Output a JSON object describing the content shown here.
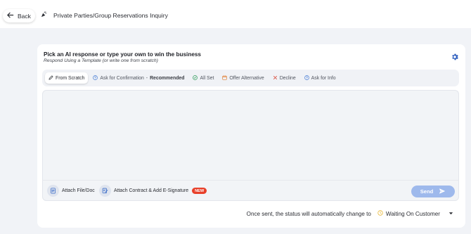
{
  "header": {
    "back_label": "Back",
    "page_title": "Private Parties/Group Reservations Inquiry"
  },
  "composer": {
    "heading": "Pick an AI response or type your own to win the business",
    "subheading": "Respond Using a Template (or write one from scratch)",
    "tabs": [
      {
        "label": "From Scratch",
        "icon": "pencil-icon",
        "active": true
      },
      {
        "label": "Ask for Confirmation",
        "suffix": "Recommended",
        "icon": "question-circle-icon"
      },
      {
        "label": "All Set",
        "icon": "check-circle-icon"
      },
      {
        "label": "Offer Alternative",
        "icon": "calendar-icon"
      },
      {
        "label": "Decline",
        "icon": "x-icon"
      },
      {
        "label": "Ask for Info",
        "icon": "question-circle-icon"
      }
    ],
    "tab_separator": "-",
    "attach_file_label": "Attach File/Doc",
    "attach_contract_label": "Attach Contract & Add E-Signature",
    "new_badge": "NEW",
    "send_label": "Send"
  },
  "status": {
    "note": "Once sent, the status will automatically change to",
    "selected": "Waiting On Customer"
  },
  "colors": {
    "accent": "#9eb9ec",
    "new_badge": "#e8402a",
    "icon_blue": "#4a7fd6",
    "check_green": "#2e9c5a",
    "calendar_orange": "#e07b2d",
    "decline_red": "#d8412f",
    "waiting_yellow": "#e8b93a"
  }
}
